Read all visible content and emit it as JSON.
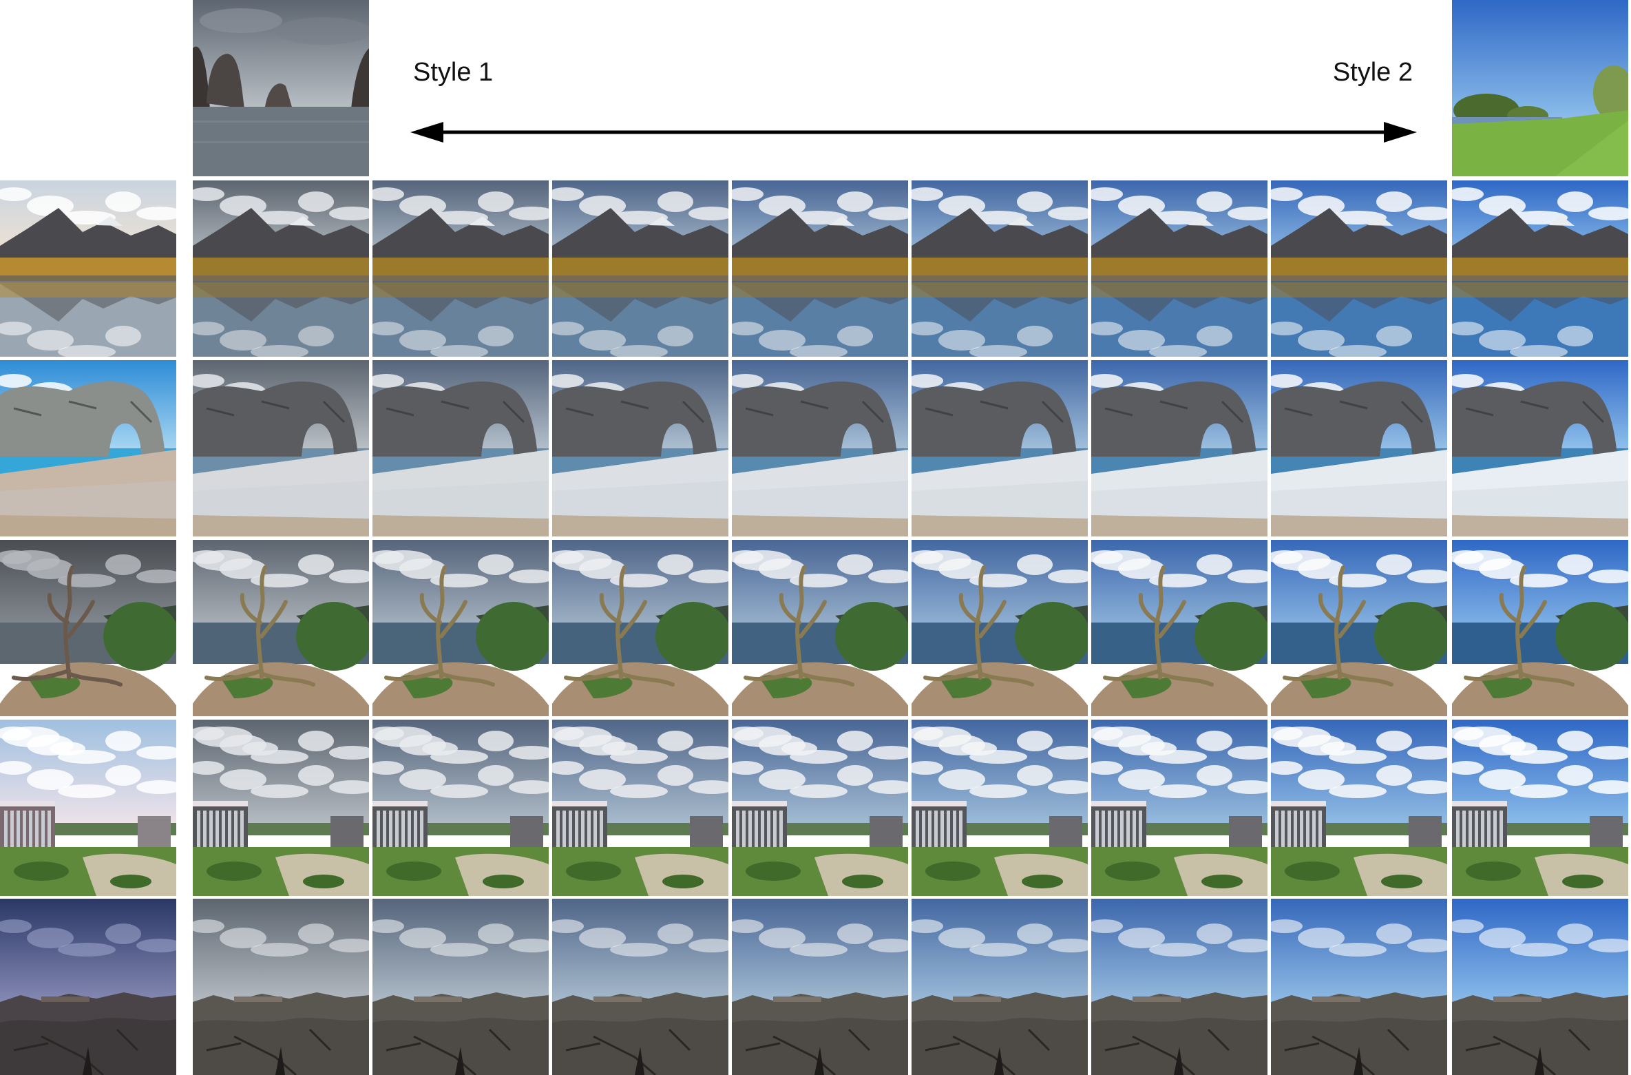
{
  "header": {
    "style1_label": "Style 1",
    "style2_label": "Style 2"
  },
  "grid": {
    "columns": 9,
    "interpolation_steps": 7,
    "rows": [
      {
        "name": "mountain-lake",
        "scene": "mountain-lake"
      },
      {
        "name": "rock-arch",
        "scene": "rock-arch"
      },
      {
        "name": "dead-tree",
        "scene": "dead-tree"
      },
      {
        "name": "building",
        "scene": "building"
      },
      {
        "name": "rocky-desert",
        "scene": "rocky-desert"
      }
    ]
  },
  "colors": {
    "style1_sky_top": "#5d6570",
    "style1_sky_bottom": "#b9c0c6",
    "style2_sky_top": "#2f68c6",
    "style2_sky_bottom": "#8fc0ec",
    "style1_water": "#6c7780",
    "style2_grass": "#7ab244",
    "arrow": "#000000"
  }
}
